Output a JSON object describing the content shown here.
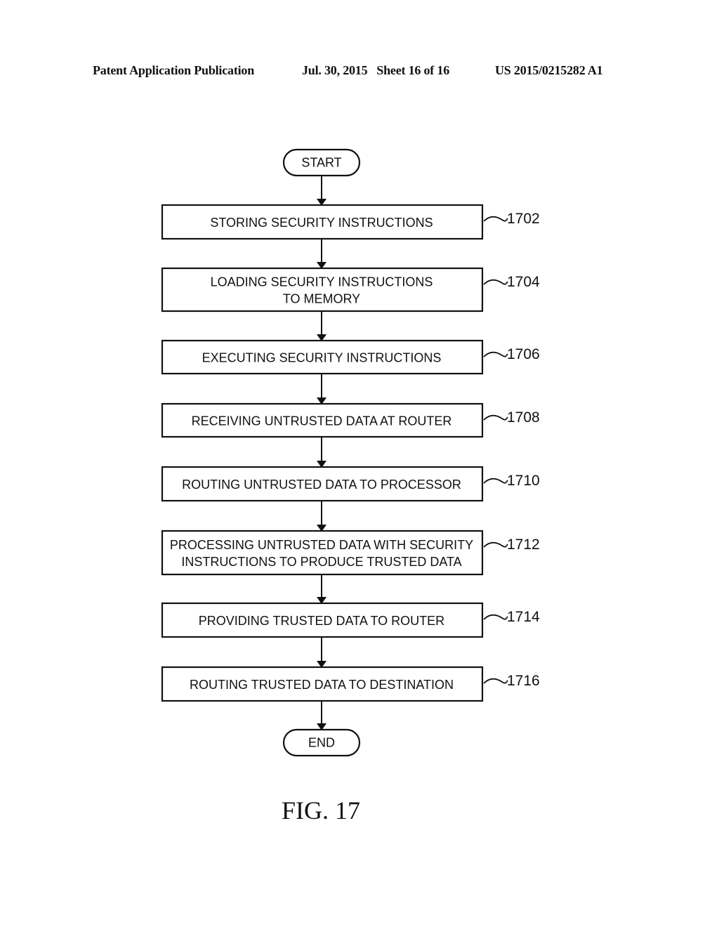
{
  "header": {
    "left": "Patent Application Publication",
    "middle": "Jul. 30, 2015   Sheet 16 of 16",
    "right": "US 2015/0215282 A1"
  },
  "flowchart": {
    "start_label": "START",
    "end_label": "END",
    "steps": [
      {
        "ref": "1702",
        "lines": [
          "STORING SECURITY INSTRUCTIONS"
        ]
      },
      {
        "ref": "1704",
        "lines": [
          "LOADING SECURITY INSTRUCTIONS",
          "TO MEMORY"
        ]
      },
      {
        "ref": "1706",
        "lines": [
          "EXECUTING SECURITY INSTRUCTIONS"
        ]
      },
      {
        "ref": "1708",
        "lines": [
          "RECEIVING UNTRUSTED DATA  AT ROUTER"
        ]
      },
      {
        "ref": "1710",
        "lines": [
          "ROUTING UNTRUSTED DATA TO PROCESSOR"
        ]
      },
      {
        "ref": "1712",
        "lines": [
          "PROCESSING UNTRUSTED DATA  WITH SECURITY",
          "INSTRUCTIONS TO PRODUCE TRUSTED DATA"
        ]
      },
      {
        "ref": "1714",
        "lines": [
          "PROVIDING TRUSTED DATA  TO ROUTER"
        ]
      },
      {
        "ref": "1716",
        "lines": [
          "ROUTING TRUSTED DATA  TO DESTINATION"
        ]
      }
    ]
  },
  "figure_label": "FIG. 17"
}
